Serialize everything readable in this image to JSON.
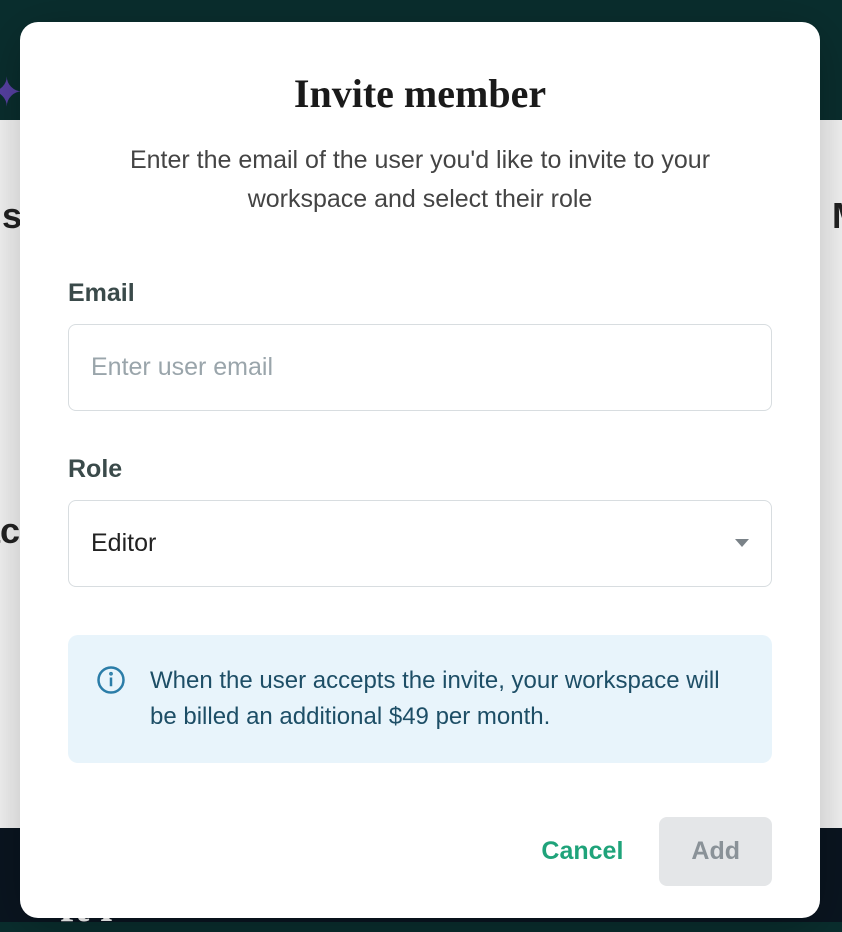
{
  "modal": {
    "title": "Invite member",
    "subtitle": "Enter the email of the user you'd like to invite to your workspace and select their role",
    "email": {
      "label": "Email",
      "placeholder": "Enter user email",
      "value": ""
    },
    "role": {
      "label": "Role",
      "selected": "Editor"
    },
    "info": {
      "text": "When the user accepts the invite, your workspace will be billed an additional $49 per month."
    },
    "buttons": {
      "cancel": "Cancel",
      "add": "Add"
    }
  }
}
